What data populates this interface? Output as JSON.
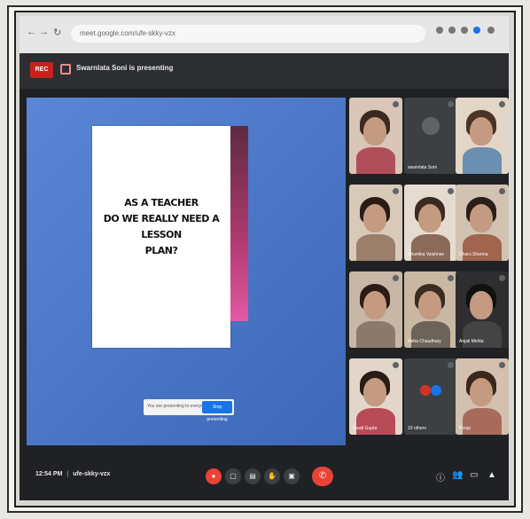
{
  "browser": {
    "url": "meet.google.com/ufe-skky-vzx",
    "back_icon": "back-arrow-icon",
    "forward_icon": "forward-arrow-icon",
    "reload_icon": "reload-icon"
  },
  "meeting": {
    "rec_label": "REC",
    "presenting_text": "Swarnlata Soni is presenting",
    "time": "12:54 PM",
    "code": "ufe-skky-vzx"
  },
  "slide": {
    "line1": "AS A TEACHER",
    "line2": "DO WE REALLY NEED A LESSON",
    "line3": "PLAN?"
  },
  "stop_presenting": {
    "prompt": "You are presenting to everyone",
    "button": "Stop presenting"
  },
  "participants": [
    {
      "name": ""
    },
    {
      "name": "swarnlata Soni"
    },
    {
      "name": ""
    },
    {
      "name": ""
    },
    {
      "name": "Bhumika Vaishnav"
    },
    {
      "name": "Charu Sharma"
    },
    {
      "name": ""
    },
    {
      "name": "Neha Chaudhary"
    },
    {
      "name": "Anjali Mehta"
    },
    {
      "name": "Swati Gupta"
    },
    {
      "name": "10 others"
    },
    {
      "name": "Pooja"
    }
  ],
  "colors": {
    "accent": "#1a73e8",
    "danger": "#ea4335",
    "presentation_bg": "#4a77c9",
    "slide_band": "#b23a72"
  }
}
